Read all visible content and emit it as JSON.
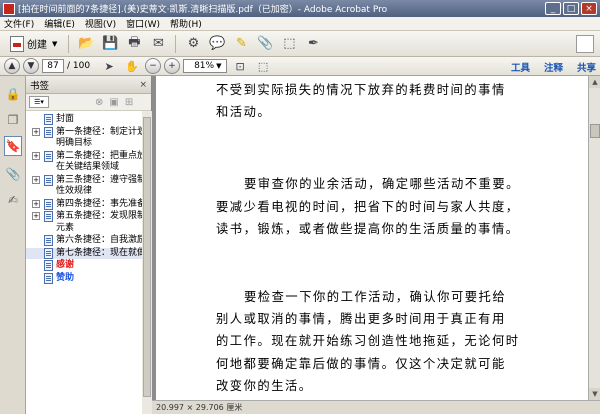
{
  "window": {
    "title": "[拍在时间前面的7条捷径].(美)史蒂文·凯斯.清晰扫描版.pdf（已加密）- Adobe Acrobat Pro",
    "minimize": "_",
    "maximize": "□",
    "close": "×"
  },
  "menu": [
    "文件(F)",
    "编辑(E)",
    "视图(V)",
    "窗口(W)",
    "帮助(H)"
  ],
  "toolbar": {
    "create_label": "创建",
    "icons": [
      "open-folder-icon",
      "save-icon",
      "print-icon",
      "email-icon",
      "settings-icon",
      "comment-icon",
      "highlight-icon",
      "attach-icon",
      "stamp-icon",
      "sign-icon"
    ]
  },
  "navigation": {
    "current_page": "87",
    "total_pages": "/ 100",
    "zoom": "81%",
    "links": {
      "tools": "工具",
      "comment": "注释",
      "share": "共享"
    }
  },
  "bookmarks": {
    "header": "书签",
    "close": "×",
    "items": [
      {
        "label": "封面",
        "expandable": false
      },
      {
        "label": "第一条捷径：制定计划明确目标",
        "expandable": true
      },
      {
        "label": "第二条捷径：把重点放在关键结果领域",
        "expandable": true
      },
      {
        "label": "第三条捷径：遵守强制性效规律",
        "expandable": true
      },
      {
        "label": "第四条捷径：事先准备",
        "expandable": true
      },
      {
        "label": "第五条捷径：发现限制元素",
        "expandable": true
      },
      {
        "label": "第六条捷径：自我激励",
        "expandable": false
      },
      {
        "label": "第七条捷径：现在就做",
        "expandable": false
      },
      {
        "label": "感谢",
        "expandable": false
      },
      {
        "label": "赞助",
        "expandable": false
      }
    ]
  },
  "document": {
    "lines": [
      "不受到实际损失的情况下放弃的耗费时间的事情",
      "和活动。",
      "要审查你的业余活动，确定哪些活动不重要。",
      "要减少看电视的时间，把省下的时间与家人共度，",
      "读书，锻炼，或者做些提高你的生活质量的事情。",
      "要检查一下你的工作活动，确认你可要托给",
      "别人或取消的事情，腾出更多时间用于真正有用",
      "的工作。现在就开始练习创造性地拖延，无论何时",
      "何地都要确定靠后做的事情。仅这个决定就可能",
      "改变你的生活。"
    ]
  },
  "status": {
    "page_size": "20.997 × 29.706 厘米"
  }
}
